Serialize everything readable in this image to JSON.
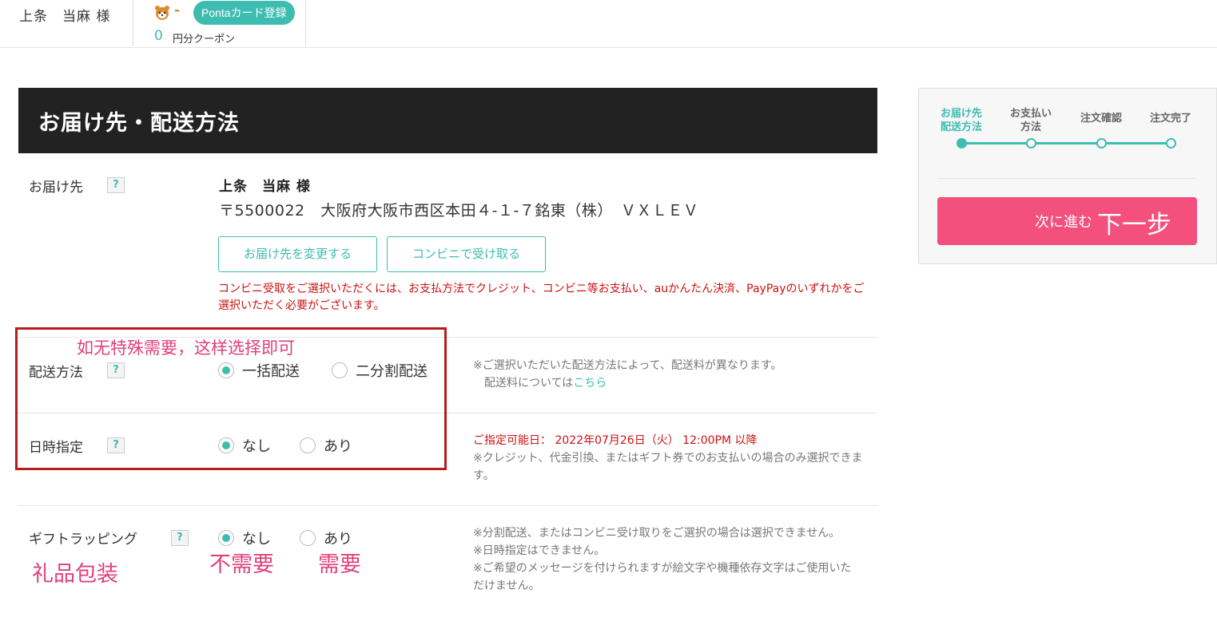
{
  "header": {
    "user_name": "上条　当麻 様",
    "ponta_points": "-",
    "ponta_button": "Pontaカード登録",
    "coupon_amount": "0",
    "coupon_label": "円分クーポン"
  },
  "page": {
    "title": "お届け先・配送方法"
  },
  "delivery": {
    "label": "お届け先",
    "help": "?",
    "recipient": "上条　当麻 様",
    "address": "〒5500022　大阪府大阪市西区本田４-１-７銘東（株）　ＶＸＬＥＶ",
    "change_button": "お届け先を変更する",
    "convenience_button": "コンビニで受け取る",
    "convenience_note": "コンビニ受取をご選択いただくには、お支払方法でクレジット、コンビニ等お支払い、auかんたん決済、PayPayのいずれかをご選択いただく必要がございます。"
  },
  "shipping": {
    "label": "配送方法",
    "help": "?",
    "options": [
      "一括配送",
      "二分割配送"
    ],
    "selected": "一括配送",
    "note_line1": "※ご選択いただいた配送方法によって、配送料が異なります。",
    "note_line2": "配送料については",
    "note_link": "こちら"
  },
  "datetime": {
    "label": "日時指定",
    "help": "?",
    "options": [
      "なし",
      "あり"
    ],
    "selected": "なし",
    "available_label": "ご指定可能日：",
    "available_date": "2022年07月26日（火） 12:00PM 以降",
    "note": "※クレジット、代金引換、またはギフト券でのお支払いの場合のみ選択できます。"
  },
  "gift": {
    "label": "ギフトラッピング",
    "help": "?",
    "options": [
      "なし",
      "あり"
    ],
    "selected": "なし",
    "note1": "※分割配送、またはコンビニ受け取りをご選択の場合は選択できません。",
    "note2": "※日時指定はできません。",
    "note3": "※ご希望のメッセージを付けられますが絵文字や機種依存文字はご使用いただけません。"
  },
  "annotations": {
    "hint": "如无特殊需要，这样选择即可",
    "gift_wrapping": "礼品包装",
    "not_needed": "不需要",
    "needed": "需要"
  },
  "steps": {
    "items": [
      {
        "label": "お届け先\n配送方法",
        "state": "done"
      },
      {
        "label": "お支払い\n方法",
        "state": "pending"
      },
      {
        "label": "注文確認",
        "state": "pending"
      },
      {
        "label": "注文完了",
        "state": "pending"
      }
    ],
    "step1": "お届け先\n配送方法",
    "step2": "お支払い\n方法",
    "step3": "注文確認",
    "step4": "注文完了"
  },
  "next_button": {
    "label": "次に進む",
    "annotation": "下一步"
  },
  "colors": {
    "accent": "#3dbdb0",
    "cta": "#f4507e",
    "warning": "#cc1111",
    "annotation_box": "#b71c1c",
    "annotation_text": "#e0407a"
  }
}
